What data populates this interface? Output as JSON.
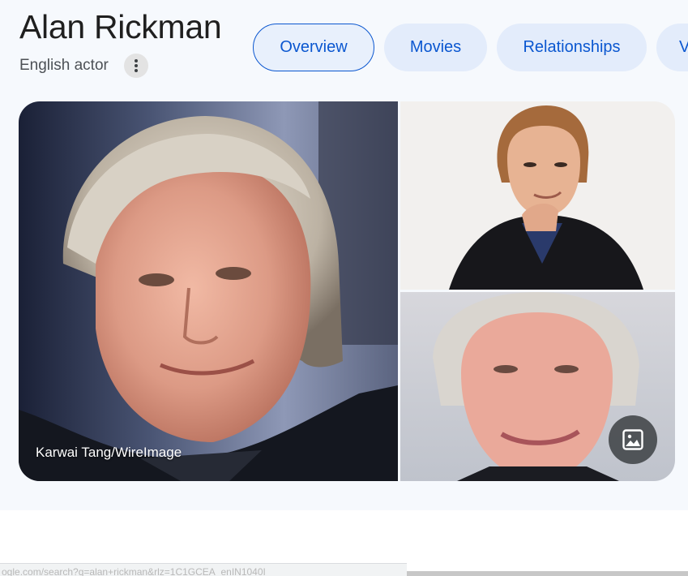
{
  "header": {
    "title": "Alan Rickman",
    "subtitle": "English actor",
    "more_icon": "more-vertical-icon"
  },
  "tabs": [
    {
      "label": "Overview",
      "active": true
    },
    {
      "label": "Movies",
      "active": false
    },
    {
      "label": "Relationships",
      "active": false
    },
    {
      "label": "V",
      "active": false
    }
  ],
  "gallery": {
    "main_caption": "Karwai Tang/WireImage",
    "images_icon": "image-gallery-icon"
  },
  "status_bar": {
    "url": "ogle.com/search?q=alan+rickman&rlz=1C1GCEA_enIN1040I"
  },
  "colors": {
    "accent": "#0b57d0",
    "chip_bg": "#e3ecfb",
    "panel_bg": "#f6f9fd"
  }
}
